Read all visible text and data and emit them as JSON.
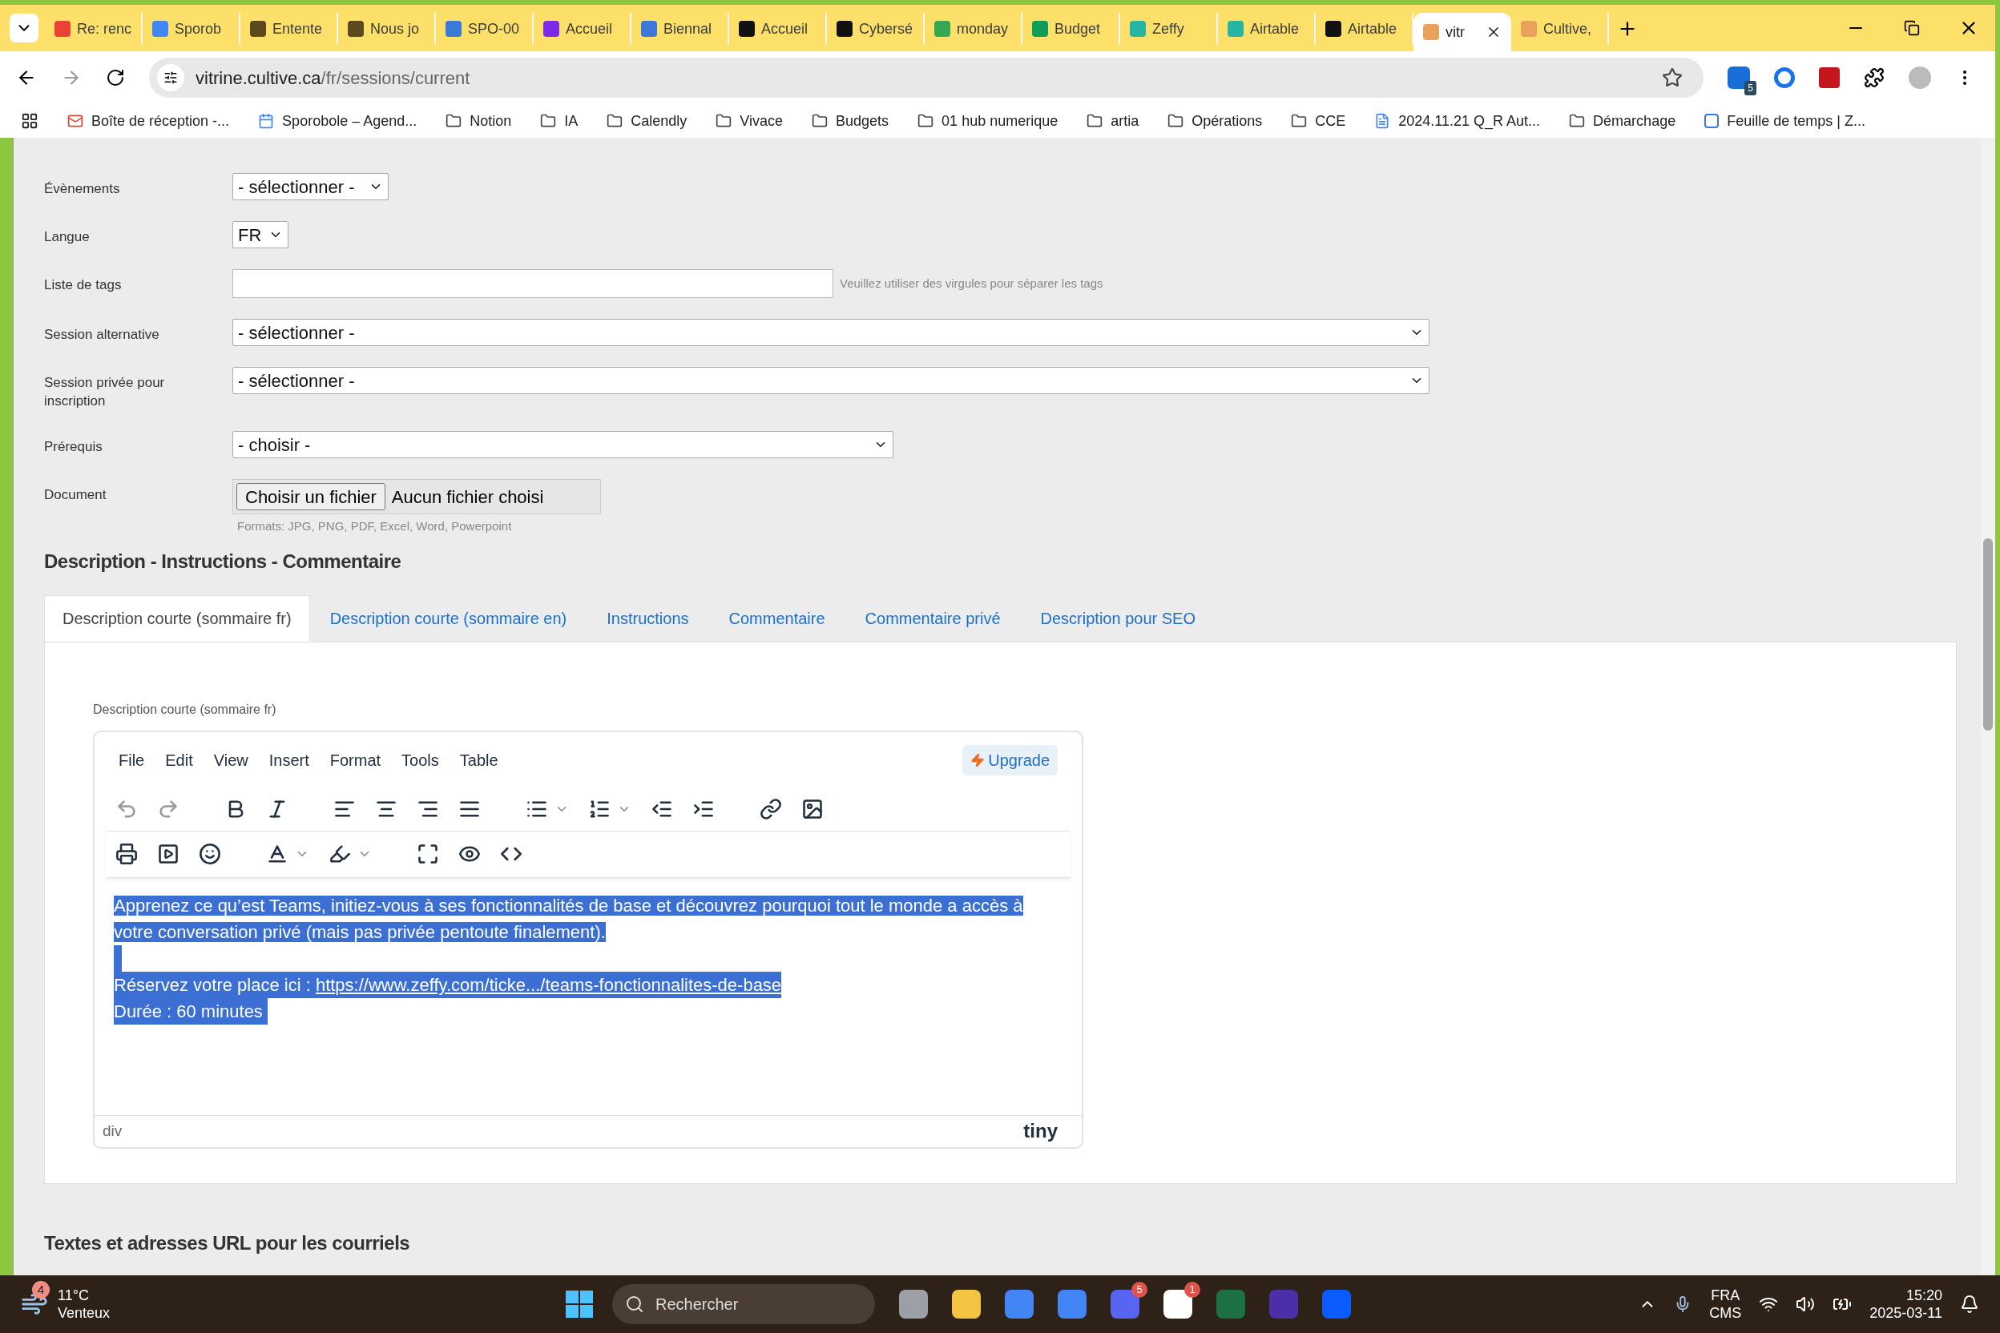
{
  "browser": {
    "tabs": [
      {
        "title": "Re: renc",
        "kind": "mail",
        "selected": false
      },
      {
        "title": "Sporob",
        "kind": "calendar",
        "selected": false
      },
      {
        "title": "Entente",
        "kind": "road",
        "selected": false
      },
      {
        "title": "Nous jo",
        "kind": "road",
        "selected": false
      },
      {
        "title": "SPO-00",
        "kind": "board",
        "selected": false
      },
      {
        "title": "Accueil",
        "kind": "canva",
        "selected": false
      },
      {
        "title": "Biennal",
        "kind": "board",
        "selected": false
      },
      {
        "title": "Accueil",
        "kind": "o1",
        "selected": false
      },
      {
        "title": "Cybersé",
        "kind": "o1",
        "selected": false
      },
      {
        "title": "monday",
        "kind": "google",
        "selected": false
      },
      {
        "title": "Budget",
        "kind": "sheet",
        "selected": false
      },
      {
        "title": "Zeffy",
        "kind": "zeffy",
        "selected": false
      },
      {
        "title": "Airtable",
        "kind": "zeffy",
        "selected": false
      },
      {
        "title": "Airtable",
        "kind": "o1",
        "selected": false
      },
      {
        "title": "vitr",
        "kind": "cultive",
        "selected": true
      },
      {
        "title": "Cultive,",
        "kind": "cultive",
        "selected": false
      }
    ],
    "url": {
      "host": "vitrine.cultive.ca",
      "path": "/fr/sessions/current"
    },
    "extension_badge": "5",
    "bookmarks": [
      {
        "label": "Boîte de réception -...",
        "kind": "mail"
      },
      {
        "label": "Sporobole – Agend...",
        "kind": "calendar"
      },
      {
        "label": "Notion",
        "kind": "folder"
      },
      {
        "label": "IA",
        "kind": "folder"
      },
      {
        "label": "Calendly",
        "kind": "folder"
      },
      {
        "label": "Vivace",
        "kind": "folder"
      },
      {
        "label": "Budgets",
        "kind": "folder"
      },
      {
        "label": "01 hub numerique",
        "kind": "folder"
      },
      {
        "label": "artia",
        "kind": "folder"
      },
      {
        "label": "Opérations",
        "kind": "folder"
      },
      {
        "label": "CCE",
        "kind": "folder"
      },
      {
        "label": "2024.11.21 Q_R Aut...",
        "kind": "doc"
      },
      {
        "label": "Démarchage",
        "kind": "folder"
      },
      {
        "label": "Feuille de temps | Z...",
        "kind": "board"
      }
    ]
  },
  "form": {
    "fields": [
      {
        "label": "Évènements",
        "kind": "select",
        "value": "- sélectionner -"
      },
      {
        "label": "Langue",
        "kind": "select",
        "value": "FR"
      },
      {
        "label": "Liste de tags",
        "kind": "text",
        "hint": "Veuillez utiliser des virgules pour séparer les tags"
      },
      {
        "label": "Session alternative",
        "kind": "select",
        "value": "- sélectionner -"
      },
      {
        "label": "Session privée pour inscription",
        "kind": "select",
        "value": "- sélectionner -"
      },
      {
        "label": "Prérequis",
        "kind": "select",
        "value": "- choisir -"
      },
      {
        "label": "Document",
        "kind": "file",
        "button": "Choisir un fichier",
        "value": "Aucun fichier choisi",
        "hint": "Formats: JPG, PNG, PDF, Excel, Word, Powerpoint"
      }
    ]
  },
  "description": {
    "heading": "Description - Instructions - Commentaire",
    "tabs": [
      {
        "label": "Description courte (sommaire fr)",
        "selected": true
      },
      {
        "label": "Description courte (sommaire en)",
        "selected": false
      },
      {
        "label": "Instructions",
        "selected": false
      },
      {
        "label": "Commentaire",
        "selected": false
      },
      {
        "label": "Commentaire privé",
        "selected": false
      },
      {
        "label": "Description pour SEO",
        "selected": false
      }
    ],
    "editor": {
      "label": "Description courte (sommaire fr)",
      "menu": [
        "File",
        "Edit",
        "View",
        "Insert",
        "Format",
        "Tools",
        "Table"
      ],
      "upgrade": "Upgrade",
      "paragraph": "Apprenez ce qu’est Teams, initiez-vous à ses fonctionnalités de base et découvrez pourquoi tout le monde a accès à votre conversation privé (mais pas privée pentoute finalement).",
      "booking": {
        "text": "Réservez votre place ici :",
        "link": "https://www.zeffy.com/ticke.../teams-fonctionnalites-de-base"
      },
      "duration": "Durée : 60 minutes",
      "path": "div",
      "brand": "tiny"
    }
  },
  "next_heading": "Textes et adresses URL pour les courriels",
  "taskbar": {
    "weather": {
      "badge": "4",
      "temperature": "11°C",
      "condition": "Venteux"
    },
    "search": {
      "placeholder": "Rechercher"
    },
    "apps": [
      {
        "kind": "files"
      },
      {
        "kind": "folder"
      },
      {
        "kind": "chrome"
      },
      {
        "kind": "chrome"
      },
      {
        "kind": "discord",
        "badge": "5"
      },
      {
        "kind": "notion",
        "badge": "1"
      },
      {
        "kind": "excel"
      },
      {
        "kind": "g"
      },
      {
        "kind": "zoom"
      }
    ],
    "tray": {
      "language": "FRA",
      "layout": "CMS",
      "time": "15:20",
      "date": "2025-03-11"
    }
  }
}
